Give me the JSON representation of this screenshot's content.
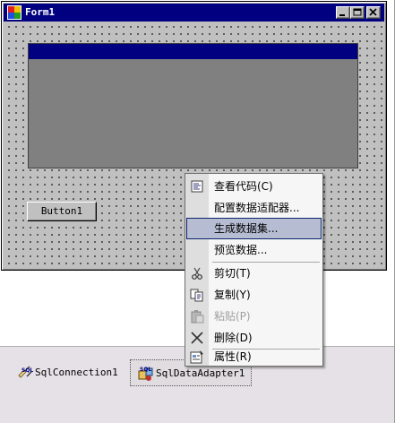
{
  "window": {
    "title": "Form1"
  },
  "form": {
    "button_label": "Button1"
  },
  "context_menu": {
    "items": [
      {
        "label": "查看代码(C)",
        "icon": "view-code-icon",
        "enabled": true
      },
      {
        "label": "配置数据适配器...",
        "icon": "",
        "enabled": true
      },
      {
        "label": "生成数据集...",
        "icon": "",
        "enabled": true,
        "highlighted": true
      },
      {
        "label": "预览数据...",
        "icon": "",
        "enabled": true
      },
      {
        "label": "剪切(T)",
        "icon": "scissors-icon",
        "enabled": true
      },
      {
        "label": "复制(Y)",
        "icon": "copy-icon",
        "enabled": true
      },
      {
        "label": "粘贴(P)",
        "icon": "paste-icon",
        "enabled": false
      },
      {
        "label": "删除(D)",
        "icon": "delete-x-icon",
        "enabled": true
      },
      {
        "label": "属性(R)",
        "icon": "properties-icon",
        "enabled": true
      }
    ]
  },
  "tray": {
    "components": [
      {
        "label": "SqlConnection1",
        "icon": "sql-connection-icon"
      },
      {
        "label": "SqlDataAdapter1",
        "icon": "sql-data-adapter-icon",
        "selected": true
      }
    ]
  },
  "colors": {
    "titlebar": "#000080",
    "menu_highlight": "#b6bdd2",
    "menu_highlight_border": "#0a246a",
    "tray_background": "#e6e1e6"
  }
}
